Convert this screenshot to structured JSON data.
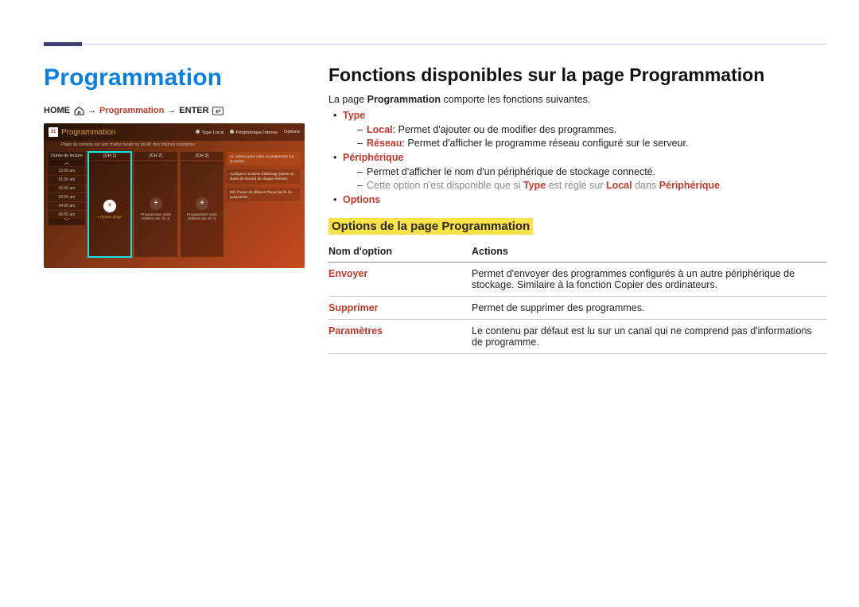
{
  "page": {
    "title": "Programmation"
  },
  "path": {
    "home": "HOME",
    "arrow": "→",
    "mid": "Programmation",
    "enter": "ENTER"
  },
  "screenshot": {
    "cal_day": "31",
    "bar_title": "Programmation",
    "bar_type_label": "Type",
    "bar_type_value": "Local",
    "bar_device_label": "Périphérique",
    "bar_device_value": "Interne",
    "bar_options": "Options",
    "subtitle": "Plage du contenu sur une chaîne locale ou modif. des chaînes existantes.",
    "time_header": "Durée de lecture",
    "times": [
      "12:00 am",
      "01:00 am",
      "02:00 am",
      "03:00 am",
      "04:00 am",
      "05:00 am"
    ],
    "channels": [
      {
        "hdr": "[CH 1]",
        "label": "+ Ajouter progr."
      },
      {
        "hdr": "[CH 2]",
        "label": "Programmez votre contenu sur ch. 2."
      },
      {
        "hdr": "[CH 3]",
        "label": "Programmez votre contenu sur ch. 3."
      }
    ],
    "side": [
      "Aj. contenu pour créer un programme sur la chaîne.",
      "Configurez la durée d'affichage (durée ou durée de lecture) de chaque élément.",
      "Déf. l'heure de début et l'heure de fin du programme."
    ]
  },
  "right": {
    "h2": "Fonctions disponibles sur la page Programmation",
    "lead_pre": "La page ",
    "lead_bold": "Programmation",
    "lead_post": " comporte les fonctions suivantes.",
    "items": {
      "type": "Type",
      "local_label": "Local",
      "local_text": ": Permet d'ajouter ou de modifier des programmes.",
      "reseau_label": "Réseau",
      "reseau_text": ": Permet d'afficher le programme réseau configuré sur le serveur.",
      "periph": "Périphérique",
      "periph_line": "Permet d'afficher le nom d'un périphérique de stockage connecté.",
      "periph_note_pre": "Cette option n'est disponible que si ",
      "periph_note_type": "Type",
      "periph_note_mid": " est réglé sur ",
      "periph_note_local": "Local",
      "periph_note_mid2": " dans ",
      "periph_note_periph": "Périphérique",
      "periph_note_end": ".",
      "options": "Options"
    },
    "subheading": "Options de la page Programmation",
    "table": {
      "col1": "Nom d'option",
      "col2": "Actions",
      "rows": [
        {
          "name": "Envoyer",
          "text": "Permet d'envoyer des programmes configurés à un autre périphérique de stockage. Similaire à la fonction Copier des ordinateurs."
        },
        {
          "name": "Supprimer",
          "text": "Permet de supprimer des programmes."
        },
        {
          "name": "Paramètres",
          "text": "Le contenu par défaut est lu sur un canal qui ne comprend pas d'informations de programme."
        }
      ]
    }
  }
}
